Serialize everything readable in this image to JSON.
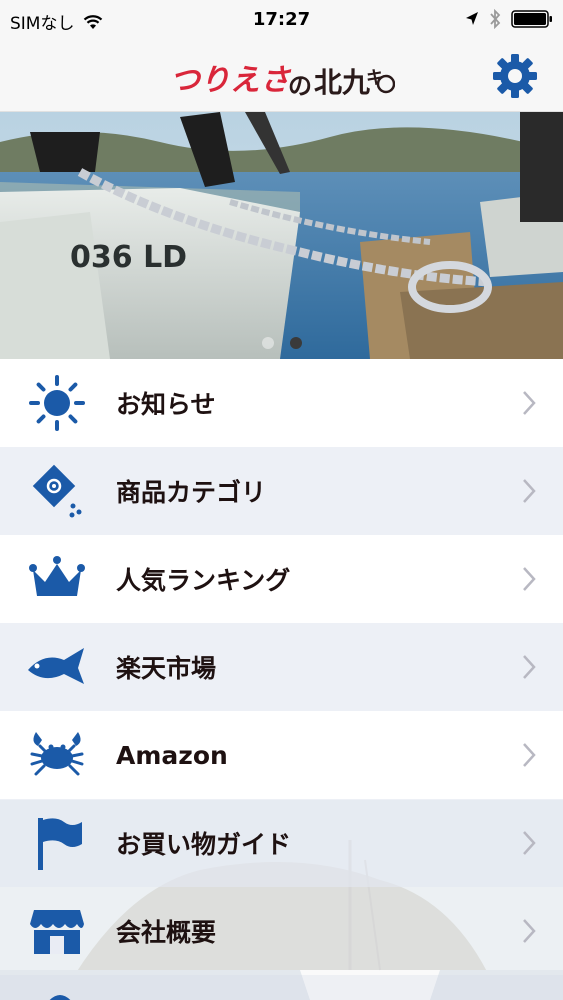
{
  "status_bar": {
    "carrier": "SIMなし",
    "time": "17:27"
  },
  "header": {
    "logo_text": "つりえさの北九キッズ",
    "icon": "gear-icon"
  },
  "hero": {
    "slide_count": 2,
    "active_slide": 2,
    "boat_label": "036 LD"
  },
  "menu": {
    "items": [
      {
        "label": "お知らせ",
        "icon": "sun-icon"
      },
      {
        "label": "商品カテゴリ",
        "icon": "tag-icon"
      },
      {
        "label": "人気ランキング",
        "icon": "crown-icon"
      },
      {
        "label": "楽天市場",
        "icon": "fish-icon"
      },
      {
        "label": "Amazon",
        "icon": "crab-icon"
      },
      {
        "label": "お買い物ガイド",
        "icon": "flag-icon"
      },
      {
        "label": "会社概要",
        "icon": "store-icon"
      }
    ]
  },
  "colors": {
    "icon_blue": "#1b5aa8",
    "label_dark": "#1e1111",
    "logo_red": "#d9263a",
    "row_alt": "#e9ecf4"
  }
}
